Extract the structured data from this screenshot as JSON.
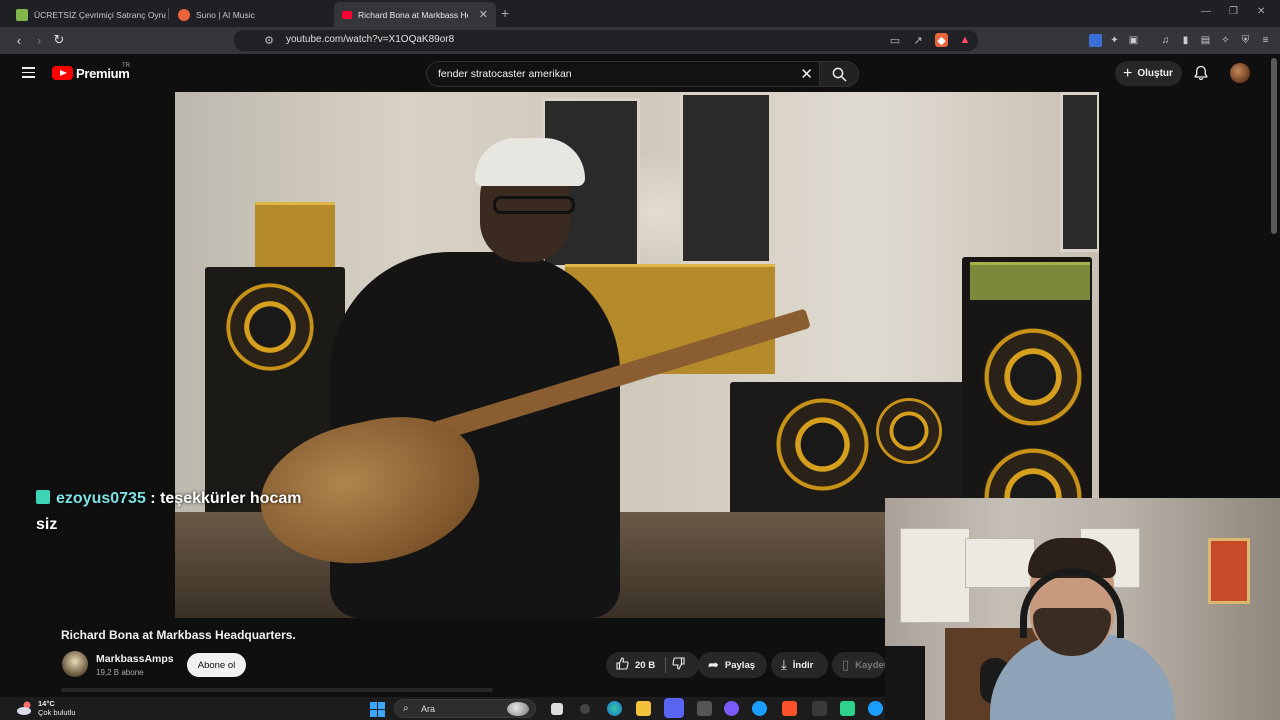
{
  "browser": {
    "tabs": [
      {
        "title": "ÜCRETSİZ Çevrimiçi Satranç Oynayın",
        "favicon_color": "#81b64c",
        "active": false
      },
      {
        "title": "Suno | AI Music",
        "favicon_color": "#e8643c",
        "active": false
      },
      {
        "title": "Richard Bona at Markbass He",
        "favicon_color": "#ff0033",
        "active": true
      }
    ],
    "url": "youtube.com/watch?v=X1OQaK89or8"
  },
  "youtube": {
    "brand": "Premium",
    "country_code": "TR",
    "search_query": "fender stratocaster amerikan",
    "create_label": "Oluştur"
  },
  "video": {
    "title": "Richard Bona at Markbass Headquarters.",
    "channel_name": "MarkbassAmps",
    "channel_subs": "19,2 B abone",
    "subscribe_label": "Abone ol",
    "like_count": "20 B",
    "share_label": "Paylaş",
    "download_label": "İndir",
    "save_label": "Kaydet"
  },
  "chat_overlay": {
    "username": "ezoyus0735",
    "message": " : teşekkürler hocam siz"
  },
  "taskbar": {
    "weather_temp": "14°C",
    "weather_desc": "Çok bulutlu",
    "search_placeholder": "Ara"
  },
  "colors": {
    "youtube_red": "#ff0000",
    "accent_chat_user": "#7ee2e2"
  }
}
